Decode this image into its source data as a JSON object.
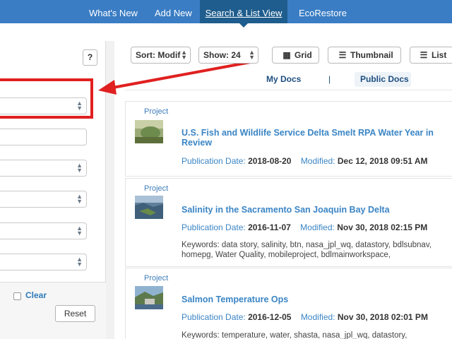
{
  "nav": {
    "tabs": [
      {
        "label": "What's New"
      },
      {
        "label": "Add New"
      },
      {
        "label": "Search & List View"
      },
      {
        "label": "EcoRestore"
      }
    ]
  },
  "sidebar": {
    "help_label": "?",
    "clear_label": "Clear",
    "reset_label": "Reset"
  },
  "toolbar": {
    "sort_label": "Sort: Modif",
    "show_label": "Show: 24",
    "grid_label": "Grid",
    "thumbnail_label": "Thumbnail",
    "list_label": "List"
  },
  "doc_tabs": {
    "my_docs": "My Docs",
    "separator": "|",
    "public_docs": "Public Docs"
  },
  "results": [
    {
      "type": "Project",
      "title": "U.S. Fish and Wildlife Service Delta Smelt RPA Water Year in Review",
      "pub_label": "Publication Date:",
      "pub_date": "2018-08-20",
      "mod_label": "Modified:",
      "mod_date": "Dec 12, 2018 09:51 AM",
      "keywords": ""
    },
    {
      "type": "Project",
      "title": "Salinity in the Sacramento San Joaquin Bay Delta",
      "pub_label": "Publication Date:",
      "pub_date": "2016-11-07",
      "mod_label": "Modified:",
      "mod_date": "Nov 30, 2018 02:15 PM",
      "keywords": "Keywords: data story, salinity, btn, nasa_jpl_wq, datastory, bdlsubnav, homepg, Water Quality, mobileproject, bdlmainworkspace,"
    },
    {
      "type": "Project",
      "title": "Salmon Temperature Ops",
      "pub_label": "Publication Date:",
      "pub_date": "2016-12-05",
      "mod_label": "Modified:",
      "mod_date": "Nov 30, 2018 02:01 PM",
      "keywords": "Keywords: temperature, water, shasta, nasa_jpl_wq, datastory,"
    }
  ],
  "colors": {
    "nav_bg": "#3a7dc4",
    "nav_active": "#1e5d8d",
    "link": "#3a85c5",
    "annotation": "#e02020"
  }
}
